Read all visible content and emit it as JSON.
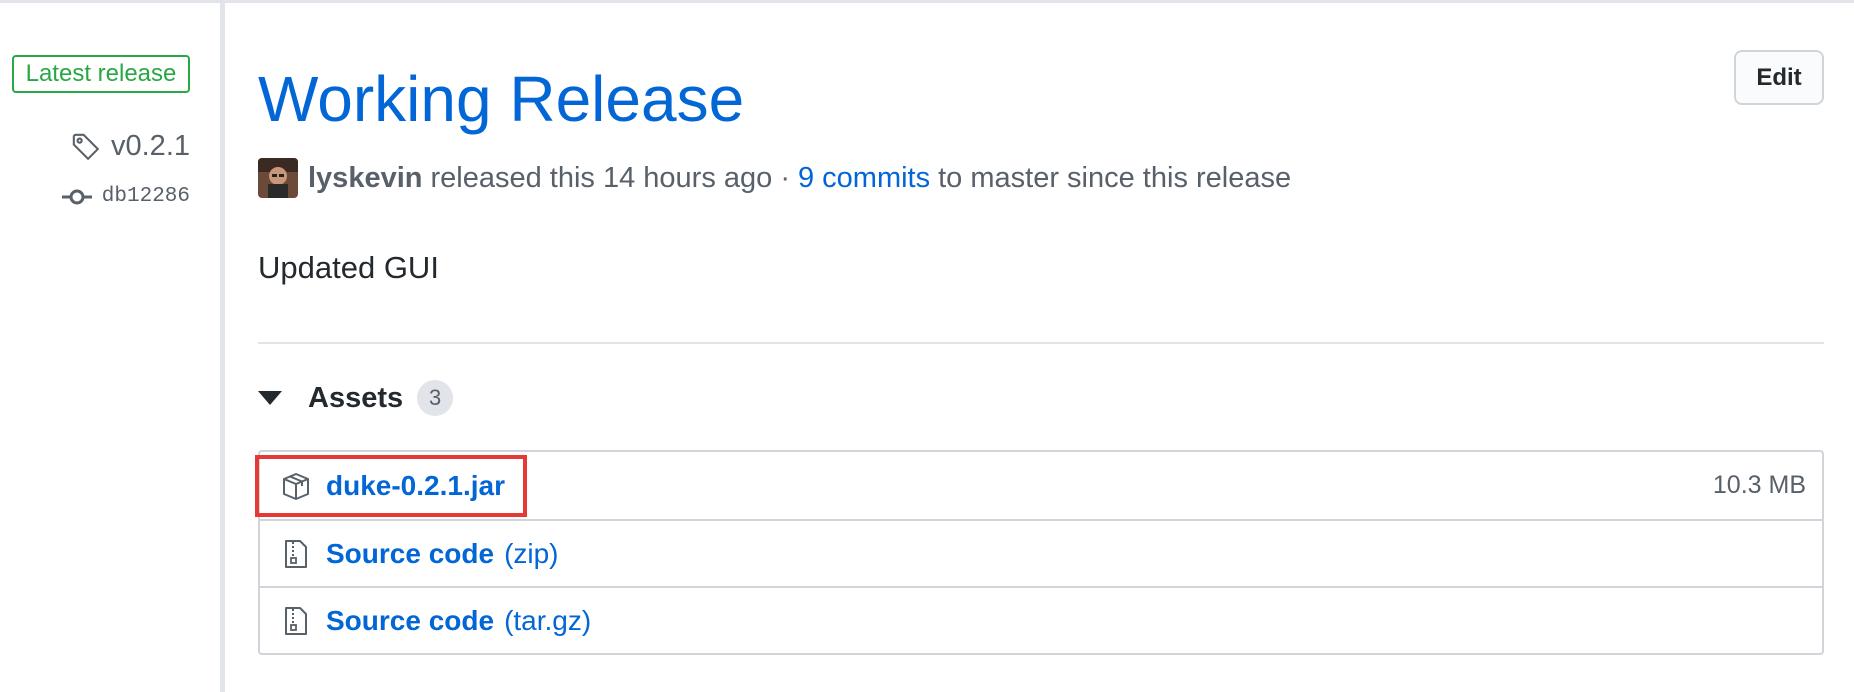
{
  "sidebar": {
    "latest_badge": "Latest release",
    "tag": "v0.2.1",
    "commit": "db12286"
  },
  "release": {
    "title": "Working Release",
    "edit_label": "Edit",
    "author": "lyskevin",
    "released_text": "released this 14 hours ago ·",
    "commits_link": "9 commits",
    "commits_suffix": "to master since this release",
    "description": "Updated GUI"
  },
  "assets": {
    "label": "Assets",
    "count": "3",
    "items": [
      {
        "name": "duke-0.2.1.jar",
        "suffix": "",
        "size": "10.3 MB",
        "icon": "package-icon"
      },
      {
        "name": "Source code",
        "suffix": "(zip)",
        "size": "",
        "icon": "file-zip-icon"
      },
      {
        "name": "Source code",
        "suffix": "(tar.gz)",
        "size": "",
        "icon": "file-zip-icon"
      }
    ]
  },
  "colors": {
    "link": "#0366d6",
    "badge_green": "#28a745",
    "highlight_red": "#e53935",
    "muted": "#586069"
  }
}
